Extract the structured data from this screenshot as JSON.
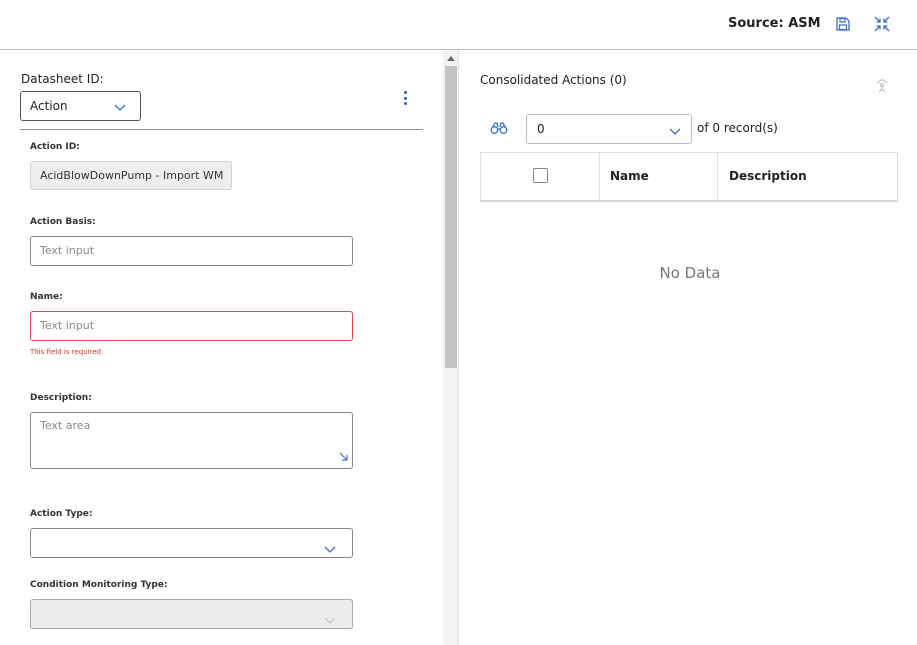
{
  "toolbar": {
    "source_label": "Source: ASM",
    "icons": [
      "save-icon",
      "collapse-icon"
    ]
  },
  "datasheet": {
    "label": "Datasheet ID:",
    "selected": "Action"
  },
  "form": {
    "action_id": {
      "label": "Action ID:",
      "value": "AcidBlowDownPump - Import WM"
    },
    "action_basis": {
      "label": "Action Basis:",
      "placeholder": "Text input"
    },
    "name": {
      "label": "Name:",
      "placeholder": "Text input",
      "error": "This field is required"
    },
    "description": {
      "label": "Description:",
      "placeholder": "Text area"
    },
    "action_type": {
      "label": "Action Type:",
      "value": ""
    },
    "condition_monitoring_type": {
      "label": "Condition Monitoring Type:",
      "value": ""
    }
  },
  "consolidated": {
    "title": "Consolidated Actions (0)",
    "page_value": "0",
    "of_label": "of",
    "total": "0",
    "records_label": "record(s)",
    "columns": [
      "Name",
      "Description"
    ],
    "empty_text": "No Data"
  },
  "colors": {
    "accent": "#3a6fc4",
    "error": "#d9322a",
    "border": "#888888"
  }
}
